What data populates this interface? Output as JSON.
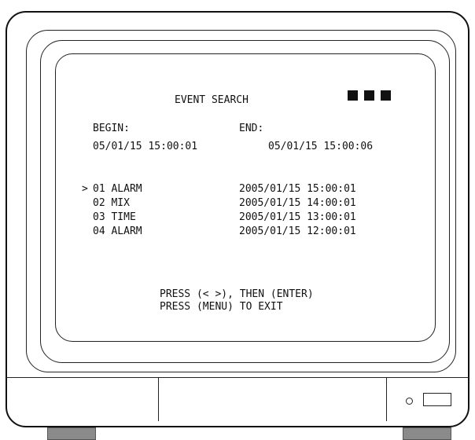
{
  "screen": {
    "title": "EVENT SEARCH",
    "status_blocks": 3,
    "begin_label": "BEGIN",
    "end_label": "END",
    "colon": ":",
    "begin_value": {
      "date": "05/01/15",
      "hh": "15",
      "mm": "00",
      "ss": "01"
    },
    "end_value": {
      "date": "05/01/15",
      "hh": "15",
      "mm": "00",
      "ss": "06"
    },
    "cursor": ">",
    "events": [
      {
        "label": "01 ALARM",
        "date": "2005/01/15",
        "hh": "15",
        "mm": "00",
        "ss": "01"
      },
      {
        "label": "02 MIX",
        "date": "2005/01/15",
        "hh": "14",
        "mm": "00",
        "ss": "01"
      },
      {
        "label": "03 TIME",
        "date": "2005/01/15",
        "hh": "13",
        "mm": "00",
        "ss": "01"
      },
      {
        "label": "04 ALARM",
        "date": "2005/01/15",
        "hh": "12",
        "mm": "00",
        "ss": "01"
      }
    ],
    "help_line1": "PRESS (< >), THEN (ENTER)",
    "help_line2": "PRESS (MENU) TO EXIT"
  }
}
